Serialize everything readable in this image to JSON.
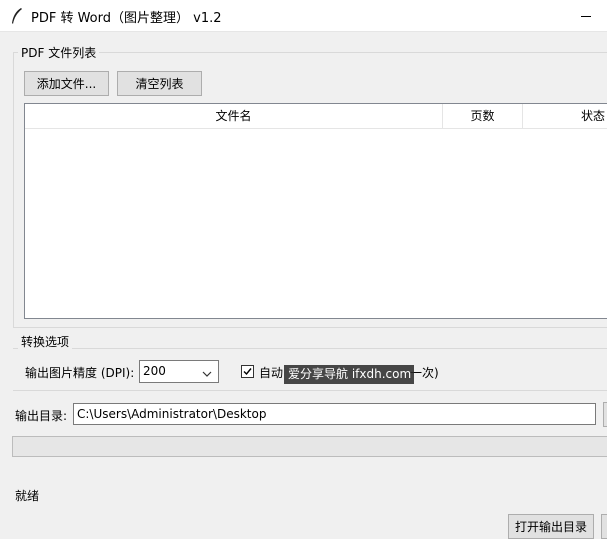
{
  "window": {
    "title": "PDF 转 Word（图片整理） v1.2"
  },
  "pdf_list": {
    "group_label": "PDF 文件列表",
    "add_button": "添加文件...",
    "clear_button": "清空列表",
    "columns": [
      "文件名",
      "页数",
      "状态"
    ],
    "rows": []
  },
  "options": {
    "group_label": "转换选项",
    "dpi_label": "输出图片精度 (DPI):",
    "dpi_value": "200",
    "auto_checkbox_checked": true,
    "auto_checkbox_label_visible": "自动",
    "auto_checkbox_label_tail": "一次)"
  },
  "watermark": {
    "text": "爱分享导航 ifxdh.com"
  },
  "output": {
    "label": "输出目录:",
    "path": "C:\\Users\\Administrator\\Desktop"
  },
  "progress": {
    "value": 0
  },
  "status": {
    "text": "就绪"
  },
  "footer": {
    "open_output_button": "打开输出目录"
  },
  "colors": {
    "window_bg": "#f0f0f0",
    "button_bg": "#e1e1e1",
    "progress_fill": "#06b025"
  }
}
